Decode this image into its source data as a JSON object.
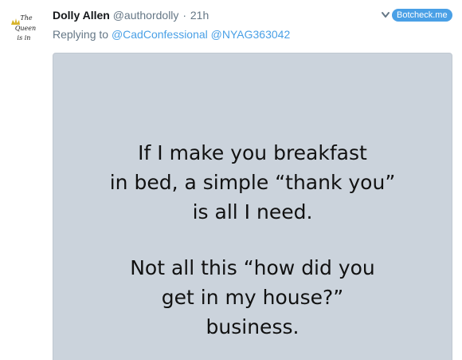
{
  "author": {
    "name": "Dolly Allen",
    "handle": "@authordolly",
    "separator": "·",
    "time": "21h",
    "avatar_text": [
      "The",
      "Queen",
      "is in"
    ]
  },
  "botcheck": {
    "label": "Botcheck.me"
  },
  "reply": {
    "prefix": "Replying to",
    "mentions": [
      "@CadConfessional",
      "@NYAG363042"
    ]
  },
  "media": {
    "lines": [
      "If I make you breakfast",
      "in bed, a simple “thank you”",
      "is all I need.",
      "Not all this “how did you",
      "get in my house?”",
      "business."
    ]
  },
  "colors": {
    "link": "#4aa0e6",
    "muted": "#657786",
    "image_bg": "#cbd3dc"
  }
}
